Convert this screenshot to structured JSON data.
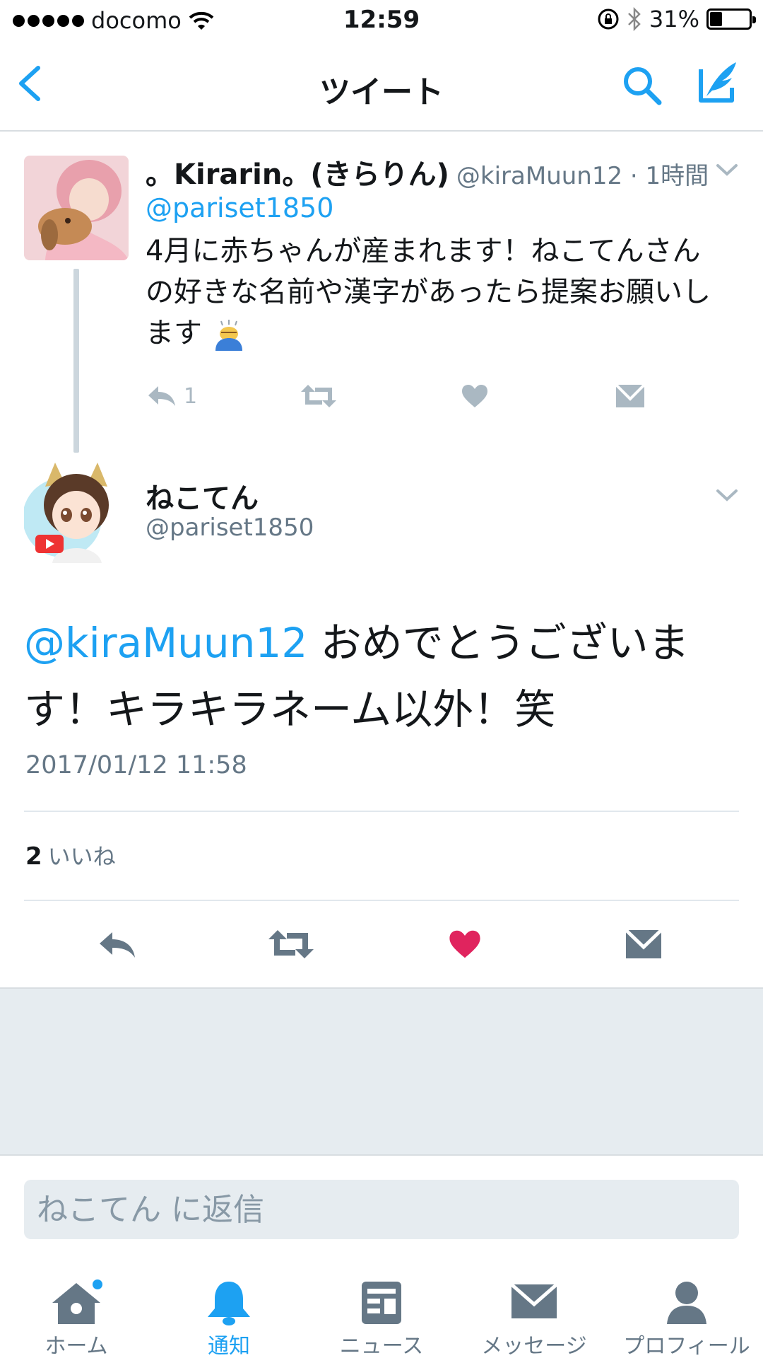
{
  "status_bar": {
    "carrier": "docomo",
    "time": "12:59",
    "battery_percent": "31%",
    "battery_level": 0.31,
    "icons": [
      "signal-dots-icon",
      "wifi-icon",
      "rotation-lock-icon",
      "bluetooth-icon",
      "battery-icon"
    ]
  },
  "nav": {
    "title": "ツイート",
    "icons": [
      "back-chevron-icon",
      "search-icon",
      "compose-icon"
    ]
  },
  "parent_tweet": {
    "name": "。Kirarin。(きらりん)",
    "handle_time": "@kiraMuun12 · 1時間",
    "mention": "@pariset1850",
    "text": "4月に赤ちゃんが産まれます！ねこてんさんの好きな名前や漢字があったら提案お願いします",
    "reply_count": "1",
    "action_icons": [
      "reply-icon",
      "retweet-icon",
      "like-icon",
      "direct-message-icon"
    ]
  },
  "main_tweet": {
    "name": "ねこてん",
    "handle": "@pariset1850",
    "mention": "@kiraMuun12",
    "text": " おめでとうございます！キラキラネーム以外！笑",
    "date": "2017/01/12 11:58",
    "like_count": "2",
    "like_label": "いいね",
    "liked": true,
    "colors": {
      "link": "#1da1f2",
      "like_active": "#e0245e",
      "action": "#657786"
    }
  },
  "reply": {
    "placeholder": "ねこてん に返信"
  },
  "tab_bar": {
    "tabs": [
      {
        "label": "ホーム",
        "icon": "home-icon",
        "badge": true
      },
      {
        "label": "通知",
        "icon": "notification-bell-icon",
        "active": true
      },
      {
        "label": "ニュース",
        "icon": "news-icon"
      },
      {
        "label": "メッセージ",
        "icon": "messages-icon"
      },
      {
        "label": "プロフィール",
        "icon": "profile-icon"
      }
    ]
  }
}
